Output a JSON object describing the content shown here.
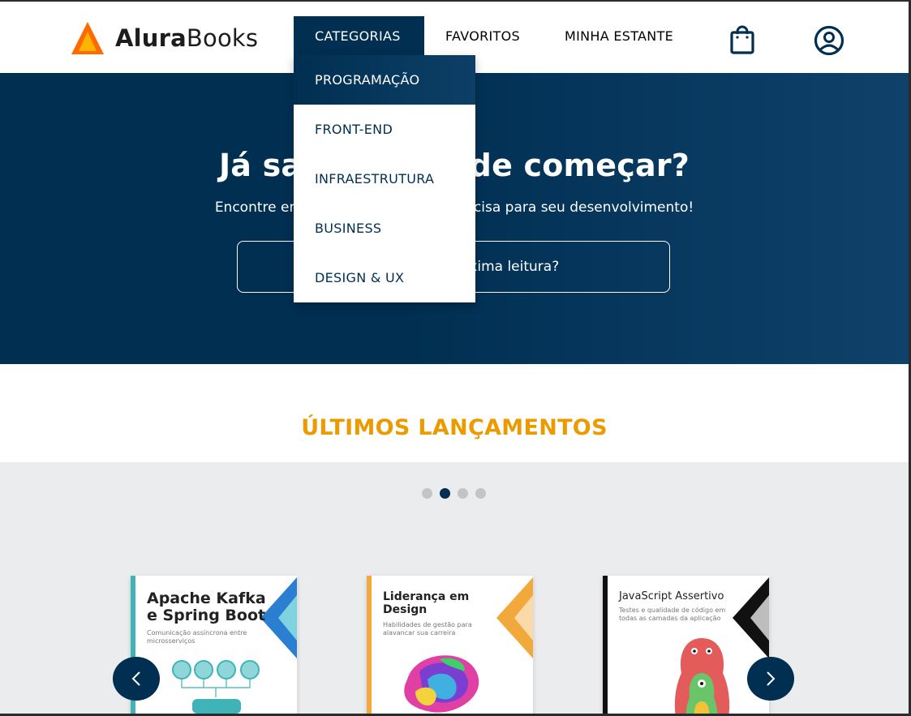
{
  "header": {
    "logo_bold": "Alura",
    "logo_light": "Books",
    "nav": {
      "categories": "CATEGORIAS",
      "favorites": "FAVORITOS",
      "shelf": "MINHA ESTANTE"
    }
  },
  "dropdown": {
    "items": [
      "PROGRAMAÇÃO",
      "FRONT-END",
      "INFRAESTRUTURA",
      "BUSINESS",
      "DESIGN & UX"
    ],
    "active_index": 0
  },
  "hero": {
    "title": "Já sabe por onde começar?",
    "subtitle": "Encontre em nossa estante o que precisa para seu desenvolvimento!",
    "search_placeholder": "Qual será sua próxima leitura?"
  },
  "releases": {
    "title": "ÚLTIMOS LANÇAMENTOS",
    "dots_count": 4,
    "active_dot": 1,
    "books": [
      {
        "title": "Apache Kafka e Spring Boot",
        "subtitle": "Comunicação assíncrona entre microsserviços",
        "accent": "#3fb3b8",
        "chevron": "#2a7fd1"
      },
      {
        "title": "Liderança em Design",
        "subtitle": "Habilidades de gestão para alavancar sua carreira",
        "accent": "#f2a93b",
        "chevron": "#f2a93b"
      },
      {
        "title": "JavaScript Assertivo",
        "subtitle": "Testes e qualidade de código em todas as camadas da aplicação",
        "accent": "#111111",
        "chevron": "#111111"
      }
    ]
  },
  "colors": {
    "primary": "#002f52",
    "accent_orange": "#eb9b00",
    "logo_orange": "#ff6a00"
  },
  "icons": {
    "bag": "shopping-bag-icon",
    "user": "user-circle-icon",
    "prev": "chevron-left-icon",
    "next": "chevron-right-icon"
  }
}
